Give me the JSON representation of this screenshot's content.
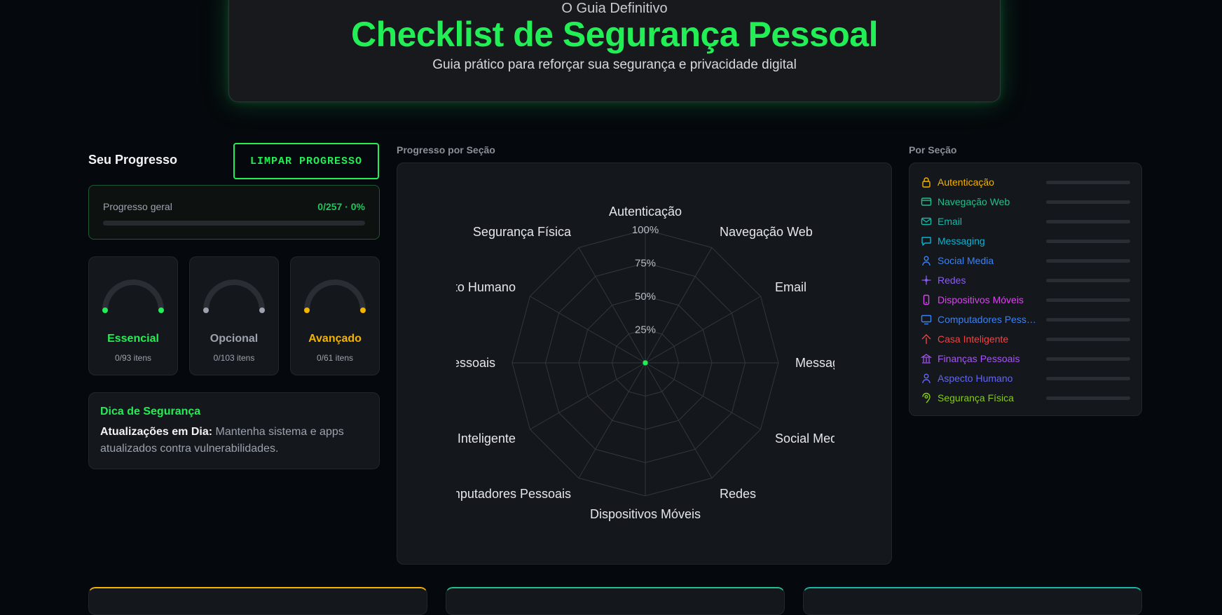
{
  "hero": {
    "kicker": "O Guia Definitivo",
    "title": "Checklist de Segurança Pessoal",
    "subtitle": "Guia prático para reforçar sua segurança e privacidade digital"
  },
  "progress": {
    "heading": "Seu Progresso",
    "clear_label": "LIMPAR PROGRESSO",
    "overall_label": "Progresso geral",
    "overall_value": "0/257 · 0%",
    "overall_fraction": 0
  },
  "tiers": [
    {
      "name": "Essencial",
      "count": "0/93 itens",
      "color": "#22ee55",
      "fraction": 0
    },
    {
      "name": "Opcional",
      "count": "0/103 itens",
      "color": "#9ca3af",
      "fraction": 0
    },
    {
      "name": "Avançado",
      "count": "0/61 itens",
      "color": "#f5b300",
      "fraction": 0
    }
  ],
  "tip": {
    "title": "Dica de Segurança",
    "bold": "Atualizações em Dia:",
    "text": "Mantenha sistema e apps atualizados contra vulnerabilidades."
  },
  "radar": {
    "label": "Progresso por Seção",
    "levels": [
      "25%",
      "50%",
      "75%",
      "100%"
    ],
    "axes": [
      "Autenticação",
      "Navegação Web",
      "Email",
      "Messaging",
      "Social Media",
      "Redes",
      "Dispositivos Móveis",
      "Computadores Pessoais",
      "Casa Inteligente",
      "Finanças Pessoais",
      "Aspecto Humano",
      "Segurança Física"
    ],
    "values": [
      0,
      0,
      0,
      0,
      0,
      0,
      0,
      0,
      0,
      0,
      0,
      0
    ],
    "point_color": "#22ee55"
  },
  "sections": {
    "label": "Por Seção",
    "items": [
      {
        "name": "Autenticação",
        "color": "#f5b300",
        "icon": "lock-icon",
        "fraction": 0
      },
      {
        "name": "Navegação Web",
        "color": "#22c08a",
        "icon": "browser-icon",
        "fraction": 0
      },
      {
        "name": "Email",
        "color": "#14b8a6",
        "icon": "mail-icon",
        "fraction": 0
      },
      {
        "name": "Messaging",
        "color": "#06b6d4",
        "icon": "chat-icon",
        "fraction": 0
      },
      {
        "name": "Social Media",
        "color": "#3b82f6",
        "icon": "user-icon",
        "fraction": 0
      },
      {
        "name": "Redes",
        "color": "#8b5cf6",
        "icon": "network-icon",
        "fraction": 0
      },
      {
        "name": "Dispositivos Móveis",
        "color": "#d946ef",
        "icon": "phone-icon",
        "fraction": 0
      },
      {
        "name": "Computadores Pessoais",
        "color": "#3b82f6",
        "icon": "monitor-icon",
        "fraction": 0
      },
      {
        "name": "Casa Inteligente",
        "color": "#ef4444",
        "icon": "home-icon",
        "fraction": 0
      },
      {
        "name": "Finanças Pessoais",
        "color": "#a855f7",
        "icon": "bank-icon",
        "fraction": 0
      },
      {
        "name": "Aspecto Humano",
        "color": "#6366f1",
        "icon": "person-icon",
        "fraction": 0
      },
      {
        "name": "Segurança Física",
        "color": "#84cc16",
        "icon": "location-pin-icon",
        "fraction": 0
      }
    ]
  }
}
